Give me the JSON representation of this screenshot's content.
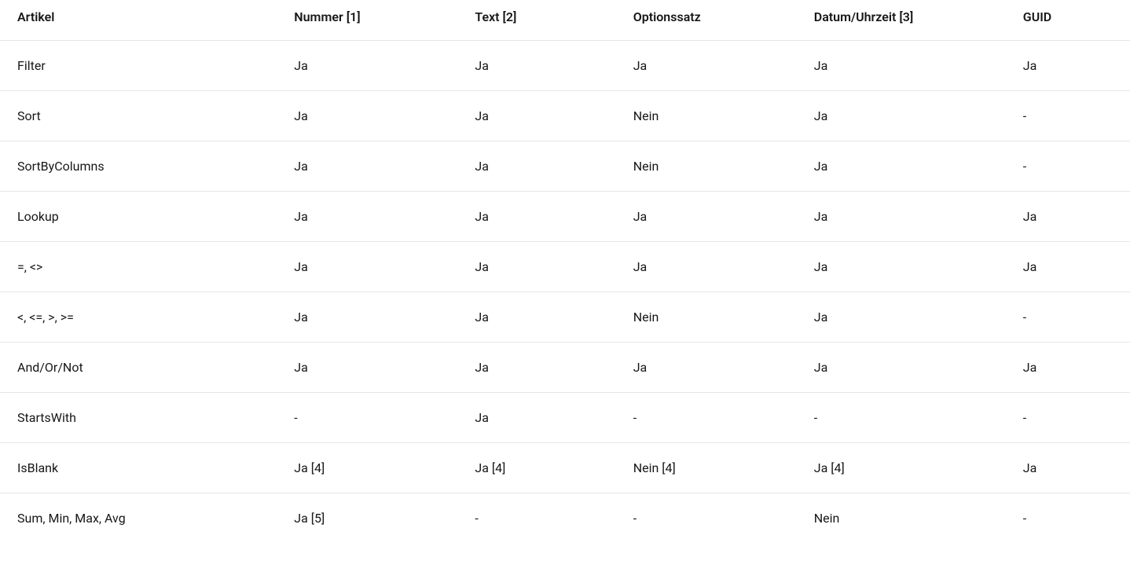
{
  "table": {
    "headers": [
      "Artikel",
      "Nummer [1]",
      "Text [2]",
      "Optionssatz",
      "Datum/Uhrzeit [3]",
      "GUID"
    ],
    "rows": [
      {
        "cells": [
          "Filter",
          "Ja",
          "Ja",
          "Ja",
          "Ja",
          "Ja"
        ]
      },
      {
        "cells": [
          "Sort",
          "Ja",
          "Ja",
          "Nein",
          "Ja",
          "-"
        ]
      },
      {
        "cells": [
          "SortByColumns",
          "Ja",
          "Ja",
          "Nein",
          "Ja",
          "-"
        ]
      },
      {
        "cells": [
          "Lookup",
          "Ja",
          "Ja",
          "Ja",
          "Ja",
          "Ja"
        ]
      },
      {
        "cells": [
          "=, <>",
          "Ja",
          "Ja",
          "Ja",
          "Ja",
          "Ja"
        ]
      },
      {
        "cells": [
          "<, <=, >, >=",
          "Ja",
          "Ja",
          "Nein",
          "Ja",
          "-"
        ]
      },
      {
        "cells": [
          "And/Or/Not",
          "Ja",
          "Ja",
          "Ja",
          "Ja",
          "Ja"
        ]
      },
      {
        "cells": [
          "StartsWith",
          "-",
          "Ja",
          "-",
          "-",
          "-"
        ]
      },
      {
        "cells": [
          "IsBlank",
          "Ja [4]",
          "Ja [4]",
          "Nein [4]",
          "Ja [4]",
          "Ja"
        ]
      },
      {
        "cells": [
          "Sum, Min, Max, Avg",
          "Ja [5]",
          "-",
          "-",
          "Nein",
          "-"
        ]
      }
    ]
  }
}
